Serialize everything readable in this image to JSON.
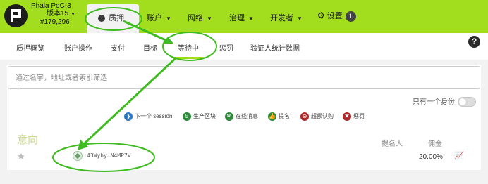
{
  "header": {
    "chain_name": "Phala PoC-3",
    "version": "版本15",
    "block": "#179,296",
    "nav": [
      {
        "label": "质押",
        "active": true
      },
      {
        "label": "账户"
      },
      {
        "label": "网络"
      },
      {
        "label": "治理"
      },
      {
        "label": "开发者"
      },
      {
        "label": "设置",
        "badge": "1"
      }
    ]
  },
  "subnav": {
    "tabs": [
      "质押概览",
      "账户操作",
      "支付",
      "目标",
      "等待中",
      "惩罚",
      "验证人统计数据"
    ],
    "active_index": 4,
    "help": "?"
  },
  "search": {
    "placeholder": "通过名字，地址或者索引筛选"
  },
  "filter": {
    "only_one_identity": "只有一个身份"
  },
  "legend": [
    {
      "icon": "next-icon",
      "label": "下一个 session",
      "color": "#2f78c4",
      "glyph": "❯"
    },
    {
      "icon": "five-icon",
      "label": "生产区块",
      "color": "#2c8a3a",
      "glyph": "5"
    },
    {
      "icon": "message-icon",
      "label": "在线消息",
      "color": "#2c8a3a",
      "glyph": "✉"
    },
    {
      "icon": "thumbs-up-icon",
      "label": "提名",
      "color": "#2c8a3a",
      "glyph": "👍"
    },
    {
      "icon": "overbooked-icon",
      "label": "超额认购",
      "color": "#b02a2a",
      "glyph": "⊖"
    },
    {
      "icon": "slash-icon",
      "label": "惩罚",
      "color": "#b02a2a",
      "glyph": "✖"
    }
  ],
  "waiting": {
    "title": "意向",
    "col_nominators": "提名人",
    "col_commission": "佣金",
    "rows": [
      {
        "account": "43Wyhy…N4MP7V",
        "commission": "20.00%"
      }
    ]
  },
  "colors": {
    "accent": "#a2de1d",
    "annotation": "#3dbb1f"
  }
}
